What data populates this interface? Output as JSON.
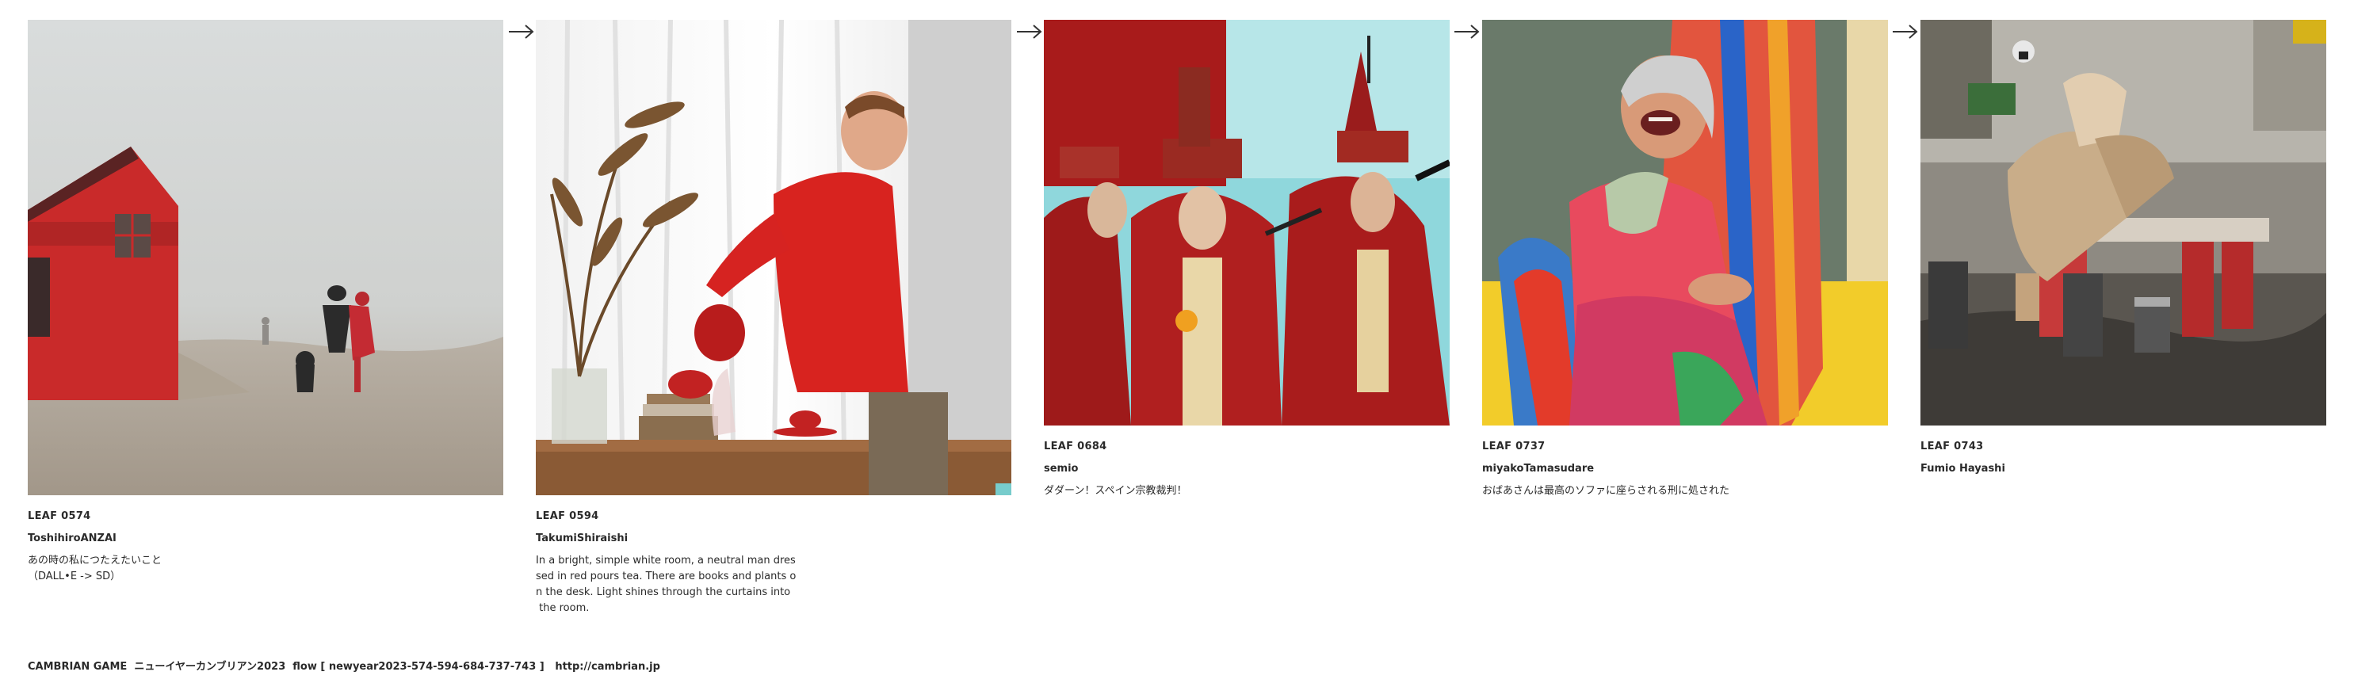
{
  "leaves": [
    {
      "id": "LEAF 0574",
      "author": "ToshihiroANZAI",
      "desc": "あの時の私につたえたいこと\n（DALL•E -> SD）",
      "image": "red-house-in-fog"
    },
    {
      "id": "LEAF 0594",
      "author": "TakumiShiraishi",
      "desc": "In a bright, simple white room, a neutral man dres\nsed in red pours tea. There are books and plants o\nn the desk. Light shines through the curtains into\n the room.",
      "image": "man-pouring-tea"
    },
    {
      "id": "LEAF 0684",
      "author": "semio",
      "desc": "ダダーン！スペイン宗教裁判！",
      "image": "red-robed-inquisitors"
    },
    {
      "id": "LEAF 0737",
      "author": "miyakoTamasudare",
      "desc": "おばあさんは最高のソファに座らされる刑に処された",
      "image": "laughing-grandmother-on-sofa"
    },
    {
      "id": "LEAF 0743",
      "author": "Fumio Hayashi",
      "desc": "",
      "image": "abstract-street-collage"
    }
  ],
  "arrow_icon": "right-arrow-icon",
  "footer": {
    "text": "CAMBRIAN GAME  ニューイヤーカンブリアン2023  flow [ newyear2023-574-594-684-737-743 ]",
    "link": "http://cambrian.jp"
  }
}
